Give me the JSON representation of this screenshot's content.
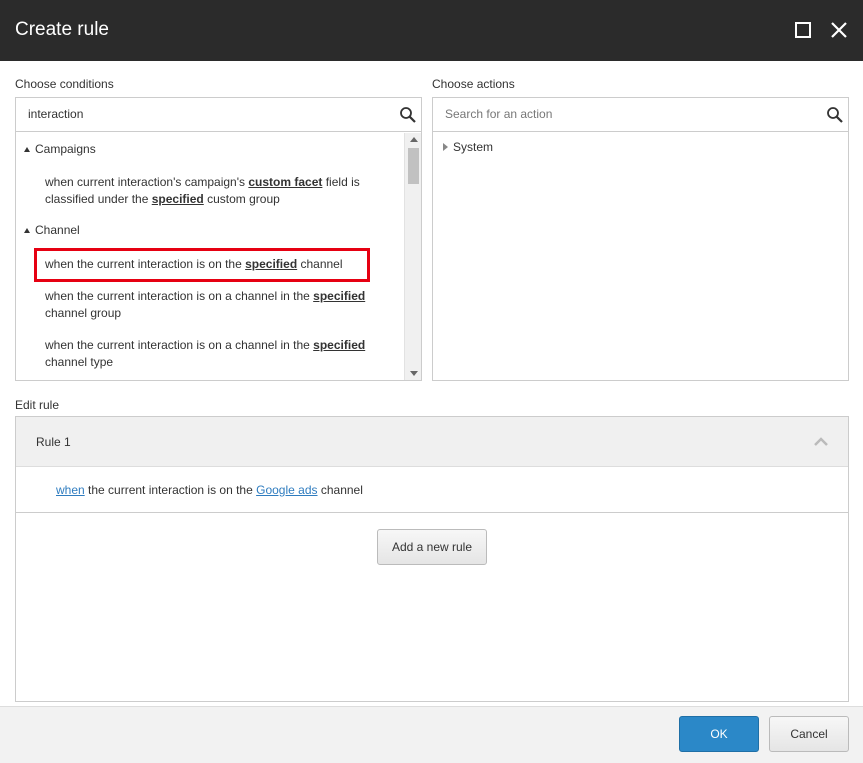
{
  "window": {
    "title": "Create rule",
    "maximize_icon": "maximize-icon",
    "close_icon": "close-icon"
  },
  "conditions": {
    "label": "Choose conditions",
    "search_value": "interaction",
    "search_icon": "search-icon",
    "groups": [
      {
        "name": "Campaigns",
        "items": [
          {
            "parts": [
              "when current interaction's campaign's ",
              "custom facet",
              " field is classified under the ",
              "specified",
              " custom group"
            ]
          }
        ]
      },
      {
        "name": "Channel",
        "items": [
          {
            "parts": [
              "when the current interaction is on the ",
              "specified",
              " channel"
            ]
          },
          {
            "parts": [
              "when the current interaction is on a channel in the ",
              "specified",
              " channel group"
            ]
          },
          {
            "parts": [
              "when the current interaction is on a channel in the ",
              "specified",
              " channel type"
            ]
          }
        ]
      }
    ]
  },
  "actions": {
    "label": "Choose actions",
    "search_placeholder": "Search for an action",
    "search_icon": "search-icon",
    "nodes": [
      "System"
    ]
  },
  "edit_rule": {
    "label": "Edit rule",
    "rule_title": "Rule 1",
    "collapse_icon": "chevron-up-icon",
    "rule_text": {
      "when": "when",
      "middle": " the current interaction is on the ",
      "channel_value": "Google ads",
      "end": " channel"
    },
    "add_rule_label": "Add a new rule"
  },
  "footer": {
    "ok_label": "OK",
    "cancel_label": "Cancel"
  },
  "colors": {
    "titlebar": "#2b2b2b",
    "highlight": "#e60012",
    "link": "#2f7cbf",
    "ok_button": "#2b88c8"
  }
}
